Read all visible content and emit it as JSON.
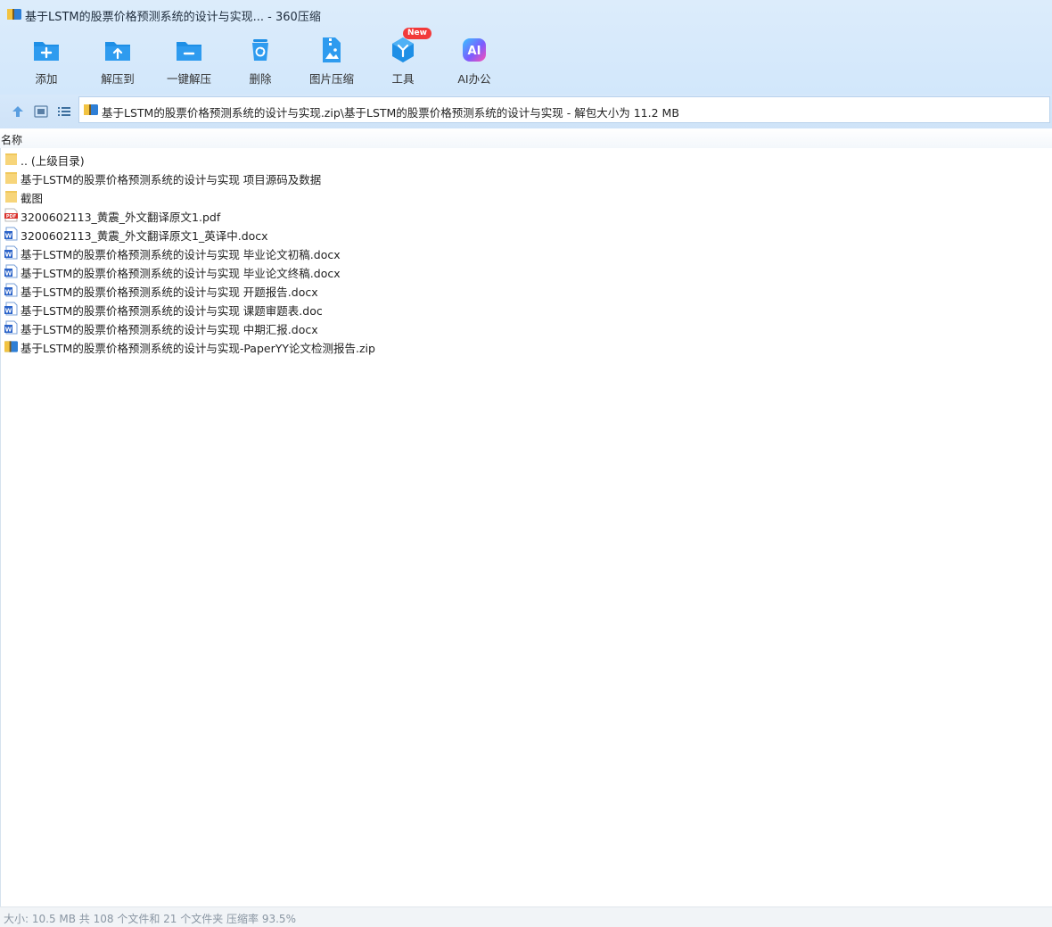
{
  "window": {
    "title": "基于LSTM的股票价格预测系统的设计与实现... - 360压缩"
  },
  "toolbar": {
    "buttons": [
      {
        "label": "添加",
        "icon": "add-icon"
      },
      {
        "label": "解压到",
        "icon": "extract-to-icon"
      },
      {
        "label": "一键解压",
        "icon": "one-click-extract-icon"
      },
      {
        "label": "删除",
        "icon": "delete-icon"
      },
      {
        "label": "图片压缩",
        "icon": "image-compress-icon"
      },
      {
        "label": "工具",
        "icon": "tools-icon",
        "badge": "New"
      },
      {
        "label": "AI办公",
        "icon": "ai-office-icon"
      }
    ]
  },
  "address": {
    "path": "基于LSTM的股票价格预测系统的设计与实现.zip\\基于LSTM的股票价格预测系统的设计与实现 - 解包大小为 11.2 MB"
  },
  "list": {
    "column_name": "名称",
    "items": [
      {
        "name": ".. (上级目录)",
        "type": "folder"
      },
      {
        "name": "基于LSTM的股票价格预测系统的设计与实现 项目源码及数据",
        "type": "folder"
      },
      {
        "name": "截图",
        "type": "folder"
      },
      {
        "name": "3200602113_黄震_外文翻译原文1.pdf",
        "type": "pdf"
      },
      {
        "name": "3200602113_黄震_外文翻译原文1_英译中.docx",
        "type": "word"
      },
      {
        "name": "基于LSTM的股票价格预测系统的设计与实现 毕业论文初稿.docx",
        "type": "word"
      },
      {
        "name": "基于LSTM的股票价格预测系统的设计与实现 毕业论文终稿.docx",
        "type": "word"
      },
      {
        "name": "基于LSTM的股票价格预测系统的设计与实现 开题报告.docx",
        "type": "word"
      },
      {
        "name": "基于LSTM的股票价格预测系统的设计与实现 课题审题表.doc",
        "type": "word"
      },
      {
        "name": "基于LSTM的股票价格预测系统的设计与实现 中期汇报.docx",
        "type": "word"
      },
      {
        "name": "基于LSTM的股票价格预测系统的设计与实现-PaperYY论文检测报告.zip",
        "type": "zip"
      }
    ]
  },
  "status": {
    "text": "大小: 10.5 MB 共 108 个文件和 21 个文件夹 压缩率 93.5%"
  },
  "colors": {
    "accent": "#1e8fe6",
    "folder": "#f7d57a",
    "pdf": "#d9302c",
    "word": "#2b63c9"
  }
}
